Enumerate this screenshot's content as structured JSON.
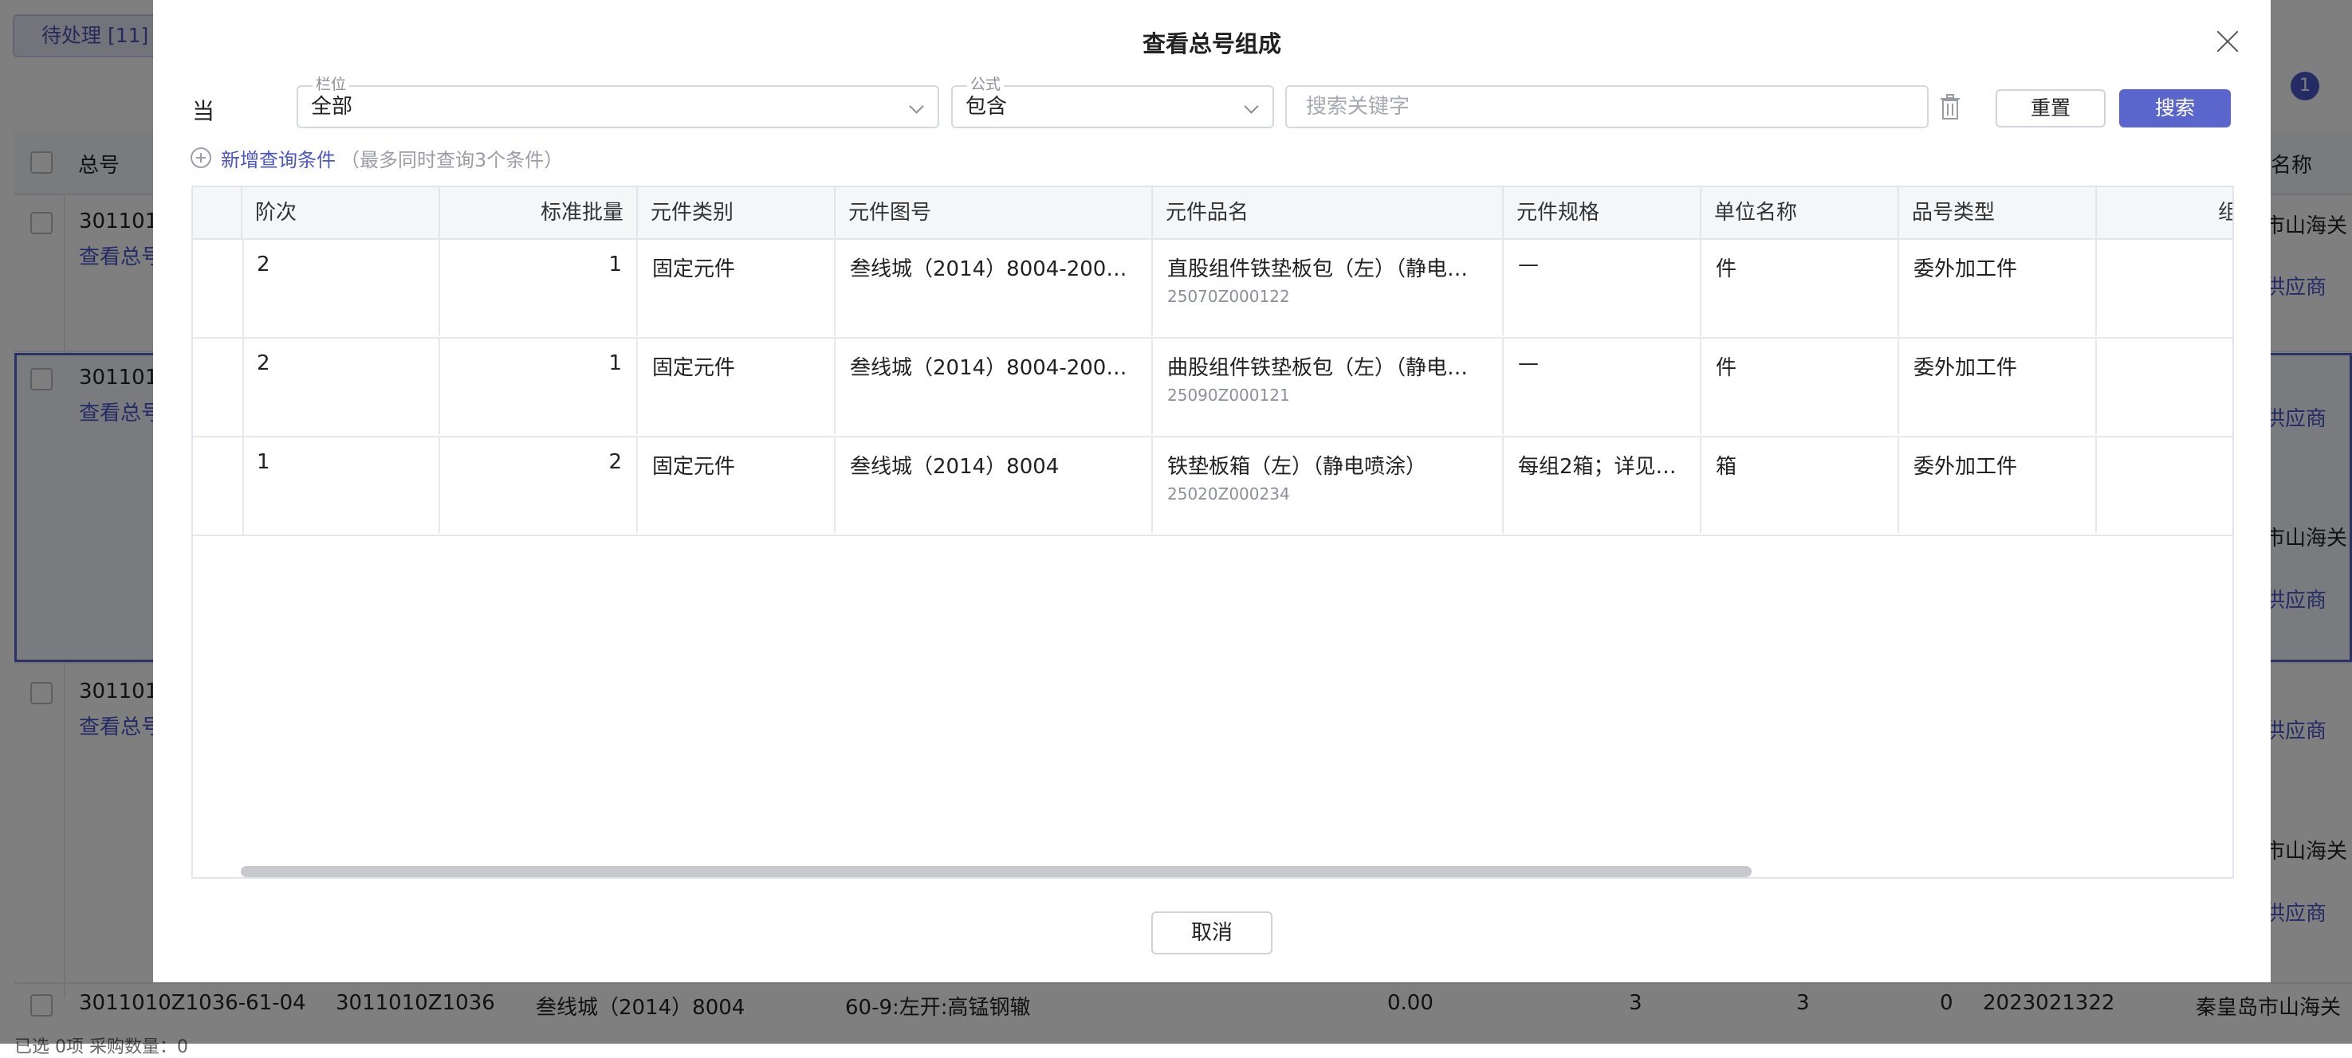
{
  "background": {
    "pending_tab": "待处理 [11]",
    "header_total_no": "总号",
    "header_name_partial": "名称",
    "rows": [
      {
        "id_partial": "3011010",
        "link": "查看总号",
        "right_text": "市山海关",
        "right_link": "供应商"
      },
      {
        "id_partial": "3011010",
        "link": "查看总号",
        "right_text": "市山海关",
        "right_link": "供应商"
      },
      {
        "id_partial": "3011010",
        "link": "查看总号",
        "right_text": "",
        "right_link": "供应商"
      }
    ],
    "extra_right_texts": [
      "市山海关",
      "供应商",
      "市山海关",
      "供应商"
    ],
    "bottom_row": [
      "3011010Z1036-61-04",
      "3011010Z1036",
      "叁线城（2014）8004",
      "60-9:左开:高锰钢辙",
      "0.00",
      "3",
      "3",
      "0",
      "2023021322",
      "秦皇岛市山海关"
    ],
    "badge_count": "1",
    "footer_partial": "已选 0项   采购数量：0"
  },
  "modal": {
    "title": "查看总号组成",
    "condition_label": "当",
    "field_column": {
      "label": "栏位",
      "value": "全部"
    },
    "field_formula": {
      "label": "公式",
      "value": "包含"
    },
    "search_placeholder": "搜索关键字",
    "reset_label": "重置",
    "search_label": "搜索",
    "add_condition_label": "新增查询条件",
    "add_condition_hint": "（最多同时查询3个条件）",
    "cancel_label": "取消"
  },
  "table": {
    "columns": [
      "阶次",
      "标准批量",
      "元件类别",
      "元件图号",
      "元件品名",
      "元件规格",
      "单位名称",
      "品号类型",
      "组成"
    ],
    "rows": [
      {
        "level": "2",
        "std_batch": "1",
        "category": "固定元件",
        "drawing_no": "叁线城（2014）8004-200…",
        "name": "直股组件铁垫板包（左）（静电…",
        "code": "25070Z000122",
        "spec": "—",
        "unit": "件",
        "type": "委外加工件"
      },
      {
        "level": "2",
        "std_batch": "1",
        "category": "固定元件",
        "drawing_no": "叁线城（2014）8004-200…",
        "name": "曲股组件铁垫板包（左）（静电…",
        "code": "25090Z000121",
        "spec": "—",
        "unit": "件",
        "type": "委外加工件"
      },
      {
        "level": "1",
        "std_batch": "2",
        "category": "固定元件",
        "drawing_no": "叁线城（2014）8004",
        "name": "铁垫板箱（左）（静电喷涂）",
        "code": "25020Z000234",
        "spec": "每组2箱；详见…",
        "unit": "箱",
        "type": "委外加工件"
      }
    ]
  },
  "colors": {
    "accent": "#5b66cc",
    "link": "#4a56c8",
    "overlay": "rgba(0,0,0,0.5)"
  },
  "icons": [
    "close-icon",
    "chevron-down-icon",
    "trash-icon",
    "plus-circle-icon"
  ]
}
